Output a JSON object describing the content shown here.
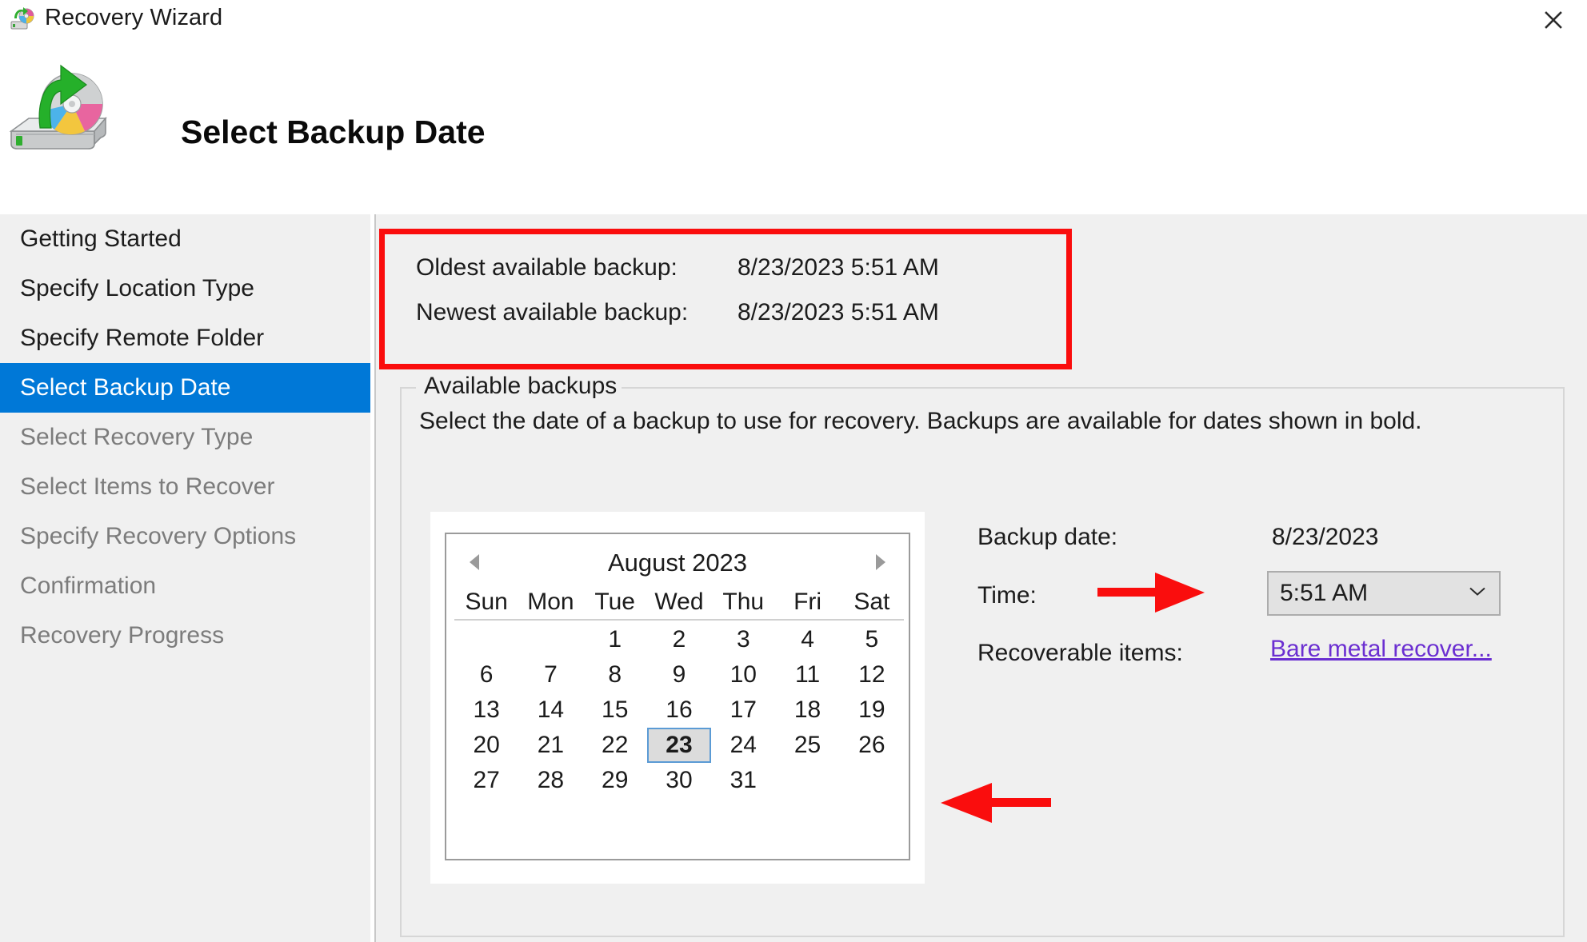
{
  "window": {
    "title": "Recovery Wizard",
    "title_icon": "recovery-wizard-icon",
    "close_label": "✕"
  },
  "header": {
    "icon": "disk-recovery-icon",
    "title": "Select Backup Date"
  },
  "sidebar": {
    "items": [
      {
        "label": "Getting Started",
        "state": "done"
      },
      {
        "label": "Specify Location Type",
        "state": "done"
      },
      {
        "label": "Specify Remote Folder",
        "state": "done"
      },
      {
        "label": "Select Backup Date",
        "state": "active"
      },
      {
        "label": "Select Recovery Type",
        "state": "future"
      },
      {
        "label": "Select Items to Recover",
        "state": "future"
      },
      {
        "label": "Specify Recovery Options",
        "state": "future"
      },
      {
        "label": "Confirmation",
        "state": "future"
      },
      {
        "label": "Recovery Progress",
        "state": "future"
      }
    ]
  },
  "backup_info": {
    "oldest_label": "Oldest available backup:",
    "oldest_value": "8/23/2023 5:51 AM",
    "newest_label": "Newest available backup:",
    "newest_value": "8/23/2023 5:51 AM"
  },
  "groupbox": {
    "legend": "Available backups",
    "description": "Select the date of a backup to use for recovery. Backups are available for dates shown in bold."
  },
  "calendar": {
    "month_title": "August 2023",
    "prev_label": "◀",
    "next_label": "▶",
    "day_headers": [
      "Sun",
      "Mon",
      "Tue",
      "Wed",
      "Thu",
      "Fri",
      "Sat"
    ],
    "weeks": [
      [
        "",
        "",
        "1",
        "2",
        "3",
        "4",
        "5"
      ],
      [
        "6",
        "7",
        "8",
        "9",
        "10",
        "11",
        "12"
      ],
      [
        "13",
        "14",
        "15",
        "16",
        "17",
        "18",
        "19"
      ],
      [
        "20",
        "21",
        "22",
        "23",
        "24",
        "25",
        "26"
      ],
      [
        "27",
        "28",
        "29",
        "30",
        "31",
        "",
        ""
      ]
    ],
    "selected_day": "23"
  },
  "details": {
    "backup_date_label": "Backup date:",
    "backup_date_value": "8/23/2023",
    "time_label": "Time:",
    "time_value": "5:51 AM",
    "recoverable_label": "Recoverable items:",
    "recoverable_link": "Bare metal recover..."
  },
  "annotations": {
    "rect_color": "#fa0d0d",
    "arrow_color": "#fa0d0d",
    "arrow_right": "points-to-time-dropdown",
    "arrow_left": "points-to-calendar"
  },
  "colors": {
    "accent": "#0078d7",
    "panel_bg": "#f0f0f0",
    "link": "#6b2fd1",
    "annotation_red": "#fa0d0d"
  }
}
